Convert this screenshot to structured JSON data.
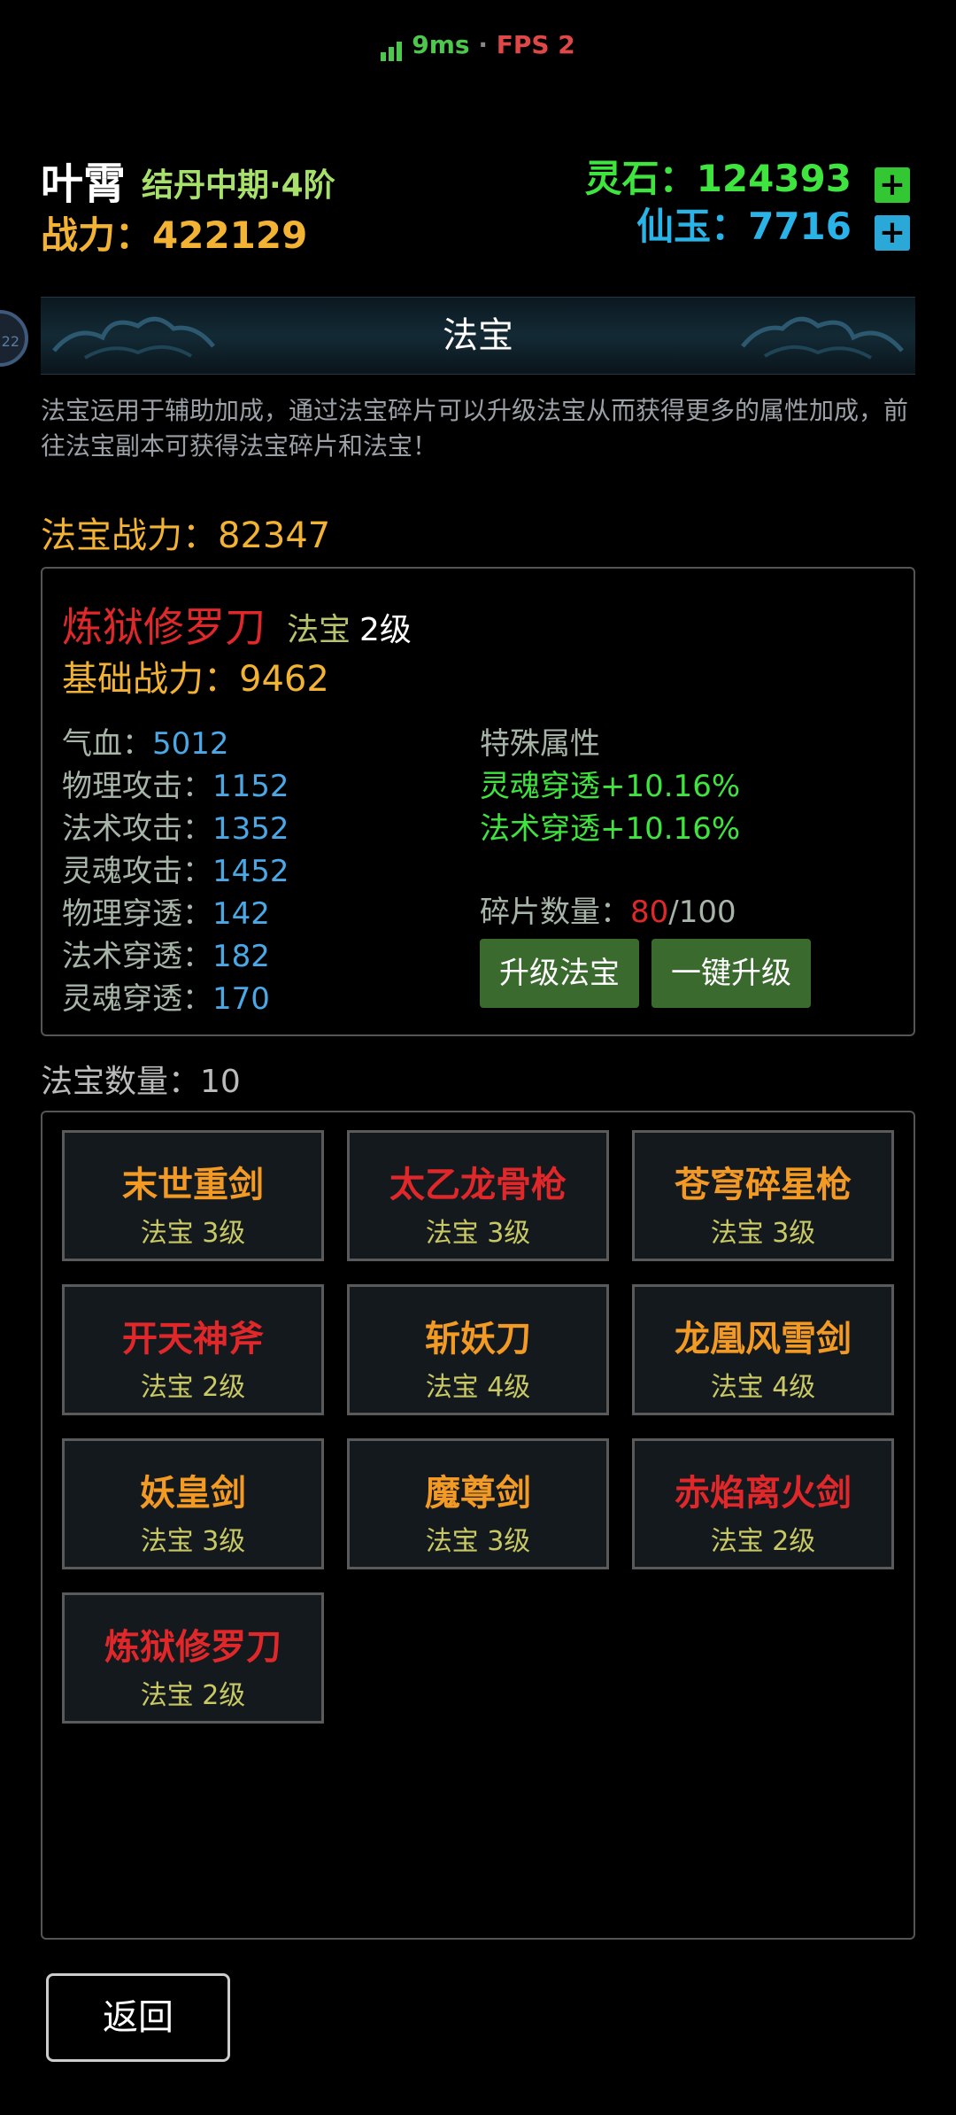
{
  "status": {
    "ping": "9ms",
    "separator": "·",
    "fps": "FPS 2"
  },
  "player": {
    "name": "叶霄",
    "realm": "结丹中期·4阶",
    "power_label": "战力：422129",
    "stone_label": "灵石：124393",
    "jade_label": "仙玉：7716",
    "plus": "+"
  },
  "banner": {
    "title": "法宝",
    "side_badge": "22"
  },
  "description": "法宝运用于辅助加成，通过法宝碎片可以升级法宝从而获得更多的属性加成，前往法宝副本可获得法宝碎片和法宝！",
  "fabao_power": "法宝战力：82347",
  "selected": {
    "name": "炼狱修罗刀",
    "type": "法宝",
    "level": "2级",
    "base_power": "基础战力：9462",
    "stats": [
      {
        "k": "气血：",
        "v": "5012"
      },
      {
        "k": "物理攻击：",
        "v": "1152"
      },
      {
        "k": "法术攻击：",
        "v": "1352"
      },
      {
        "k": "灵魂攻击：",
        "v": "1452"
      },
      {
        "k": "物理穿透：",
        "v": "142"
      },
      {
        "k": "法术穿透：",
        "v": "182"
      },
      {
        "k": "灵魂穿透：",
        "v": "170"
      }
    ],
    "special_title": "特殊属性",
    "specials": [
      "灵魂穿透+10.16%",
      "法术穿透+10.16%"
    ],
    "fragment_label": "碎片数量：",
    "fragment_current": "80",
    "fragment_total": "/100",
    "upgrade_button": "升级法宝",
    "oneclick_button": "一键升级"
  },
  "count_label": "法宝数量：10",
  "items": [
    {
      "name": "末世重剑",
      "level": "法宝 3级",
      "color": "gold"
    },
    {
      "name": "太乙龙骨枪",
      "level": "法宝 3级",
      "color": "red"
    },
    {
      "name": "苍穹碎星枪",
      "level": "法宝 3级",
      "color": "gold"
    },
    {
      "name": "开天神斧",
      "level": "法宝 2级",
      "color": "red"
    },
    {
      "name": "斩妖刀",
      "level": "法宝 4级",
      "color": "gold"
    },
    {
      "name": "龙凰风雪剑",
      "level": "法宝 4级",
      "color": "gold"
    },
    {
      "name": "妖皇剑",
      "level": "法宝 3级",
      "color": "gold"
    },
    {
      "name": "魔尊剑",
      "level": "法宝 3级",
      "color": "gold"
    },
    {
      "name": "赤焰离火剑",
      "level": "法宝 2级",
      "color": "red"
    },
    {
      "name": "炼狱修罗刀",
      "level": "法宝 2级",
      "color": "red"
    }
  ],
  "back_button": "返回"
}
